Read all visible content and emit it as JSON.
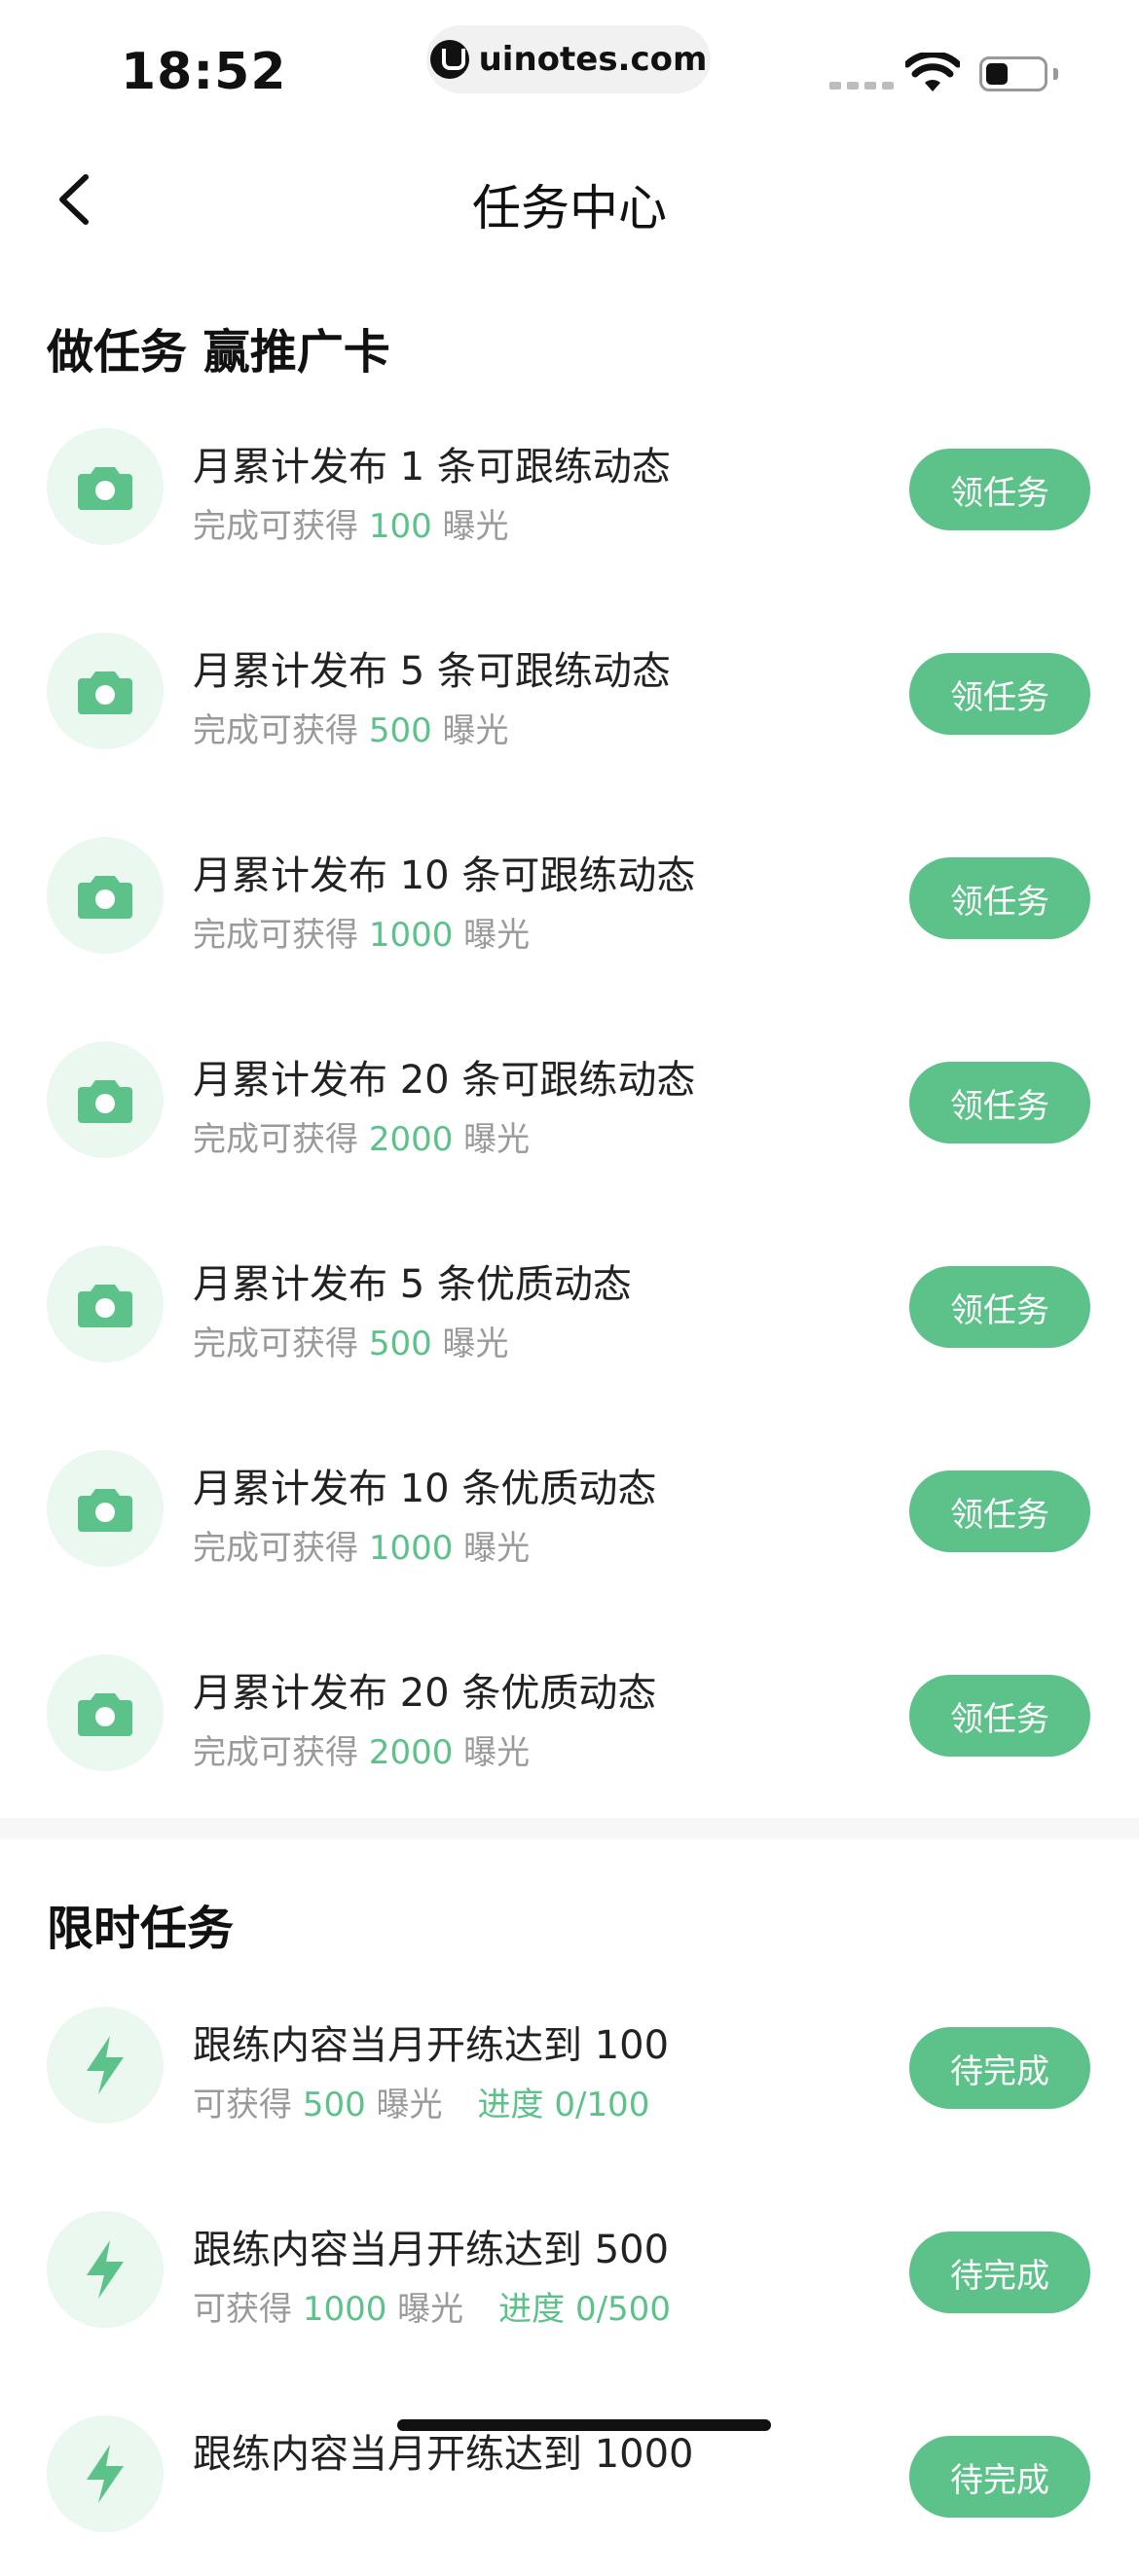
{
  "status": {
    "time": "18:52",
    "url": "uinotes.com"
  },
  "nav": {
    "title": "任务中心"
  },
  "sections": [
    {
      "title": "做任务 赢推广卡"
    },
    {
      "title": "限时任务"
    }
  ],
  "tasks": [
    {
      "title": "月累计发布 1 条可跟练动态",
      "sub_prefix": "完成可获得",
      "amount": "100",
      "unit": "曝光",
      "button": "领任务"
    },
    {
      "title": "月累计发布 5 条可跟练动态",
      "sub_prefix": "完成可获得",
      "amount": "500",
      "unit": "曝光",
      "button": "领任务"
    },
    {
      "title": "月累计发布 10 条可跟练动态",
      "sub_prefix": "完成可获得",
      "amount": "1000",
      "unit": "曝光",
      "button": "领任务"
    },
    {
      "title": "月累计发布 20 条可跟练动态",
      "sub_prefix": "完成可获得",
      "amount": "2000",
      "unit": "曝光",
      "button": "领任务"
    },
    {
      "title": "月累计发布 5 条优质动态",
      "sub_prefix": "完成可获得",
      "amount": "500",
      "unit": "曝光",
      "button": "领任务"
    },
    {
      "title": "月累计发布 10 条优质动态",
      "sub_prefix": "完成可获得",
      "amount": "1000",
      "unit": "曝光",
      "button": "领任务"
    },
    {
      "title": "月累计发布 20 条优质动态",
      "sub_prefix": "完成可获得",
      "amount": "2000",
      "unit": "曝光",
      "button": "领任务"
    }
  ],
  "limited_tasks": [
    {
      "title": "跟练内容当月开练达到 100",
      "sub_prefix": "可获得",
      "amount": "500",
      "unit": "曝光",
      "progress": "进度 0/100",
      "button": "待完成"
    },
    {
      "title": "跟练内容当月开练达到 500",
      "sub_prefix": "可获得",
      "amount": "1000",
      "unit": "曝光",
      "progress": "进度 0/500",
      "button": "待完成"
    },
    {
      "title": "跟练内容当月开练达到 1000",
      "button": "待完成"
    }
  ],
  "colors": {
    "accent": "#5cc28a",
    "icon_bg": "#eaf8ef"
  },
  "icons": {
    "task": "camera-icon",
    "limited": "lightning-icon",
    "back": "chevron-left-icon"
  }
}
